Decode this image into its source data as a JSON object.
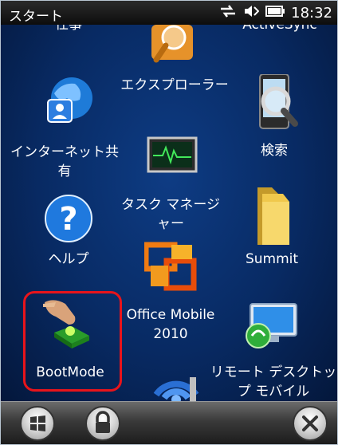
{
  "statusbar": {
    "title": "スタート",
    "time": "18:32",
    "icons": [
      "sync-arrows-icon",
      "speaker-icon",
      "battery-icon"
    ]
  },
  "tiles": {
    "shigoto_partial": "仕事",
    "activesync_partial": "ActiveSync",
    "internet_sharing": "インターネット共有",
    "explorer": "エクスプローラー",
    "search": "検索",
    "task_manager": "タスク マネージャー",
    "help": "ヘルプ",
    "summit": "Summit",
    "office_mobile": "Office Mobile 2010",
    "bootmode": "BootMode",
    "remote_desktop": "リモート デスクトップ モバイル"
  },
  "bottombar": {
    "left_icons": [
      "windows-start-icon",
      "lock-icon"
    ],
    "right_icon": "close-icon"
  },
  "colors": {
    "highlight": "#e8141b",
    "desktop_blue": "#0e3c84"
  }
}
